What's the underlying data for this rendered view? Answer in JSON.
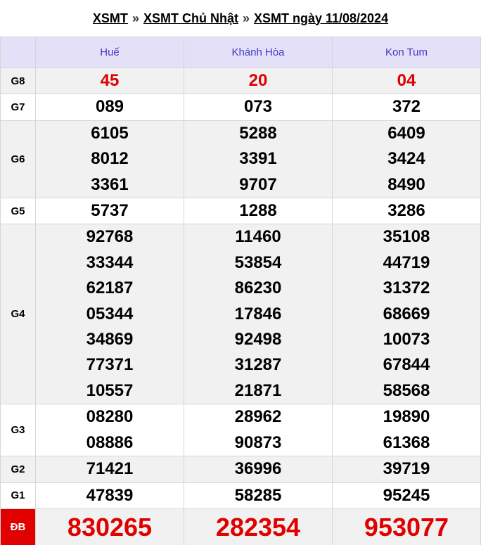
{
  "breadcrumb": {
    "items": [
      "XSMT",
      "XSMT Chủ Nhật",
      "XSMT ngày 11/08/2024"
    ],
    "separator": "»"
  },
  "colors": {
    "accent_red": "#e00000",
    "header_bg": "#e3e0f7",
    "header_text": "#4338ca"
  },
  "provinces": [
    "Huế",
    "Khánh Hòa",
    "Kon Tum"
  ],
  "prizes": [
    {
      "label": "G8",
      "values": [
        [
          "45"
        ],
        [
          "20"
        ],
        [
          "04"
        ]
      ]
    },
    {
      "label": "G7",
      "values": [
        [
          "089"
        ],
        [
          "073"
        ],
        [
          "372"
        ]
      ]
    },
    {
      "label": "G6",
      "values": [
        [
          "6105",
          "8012",
          "3361"
        ],
        [
          "5288",
          "3391",
          "9707"
        ],
        [
          "6409",
          "3424",
          "8490"
        ]
      ]
    },
    {
      "label": "G5",
      "values": [
        [
          "5737"
        ],
        [
          "1288"
        ],
        [
          "3286"
        ]
      ]
    },
    {
      "label": "G4",
      "values": [
        [
          "92768",
          "33344",
          "62187",
          "05344",
          "34869",
          "77371",
          "10557"
        ],
        [
          "11460",
          "53854",
          "86230",
          "17846",
          "92498",
          "31287",
          "21871"
        ],
        [
          "35108",
          "44719",
          "31372",
          "68669",
          "10073",
          "67844",
          "58568"
        ]
      ]
    },
    {
      "label": "G3",
      "values": [
        [
          "08280",
          "08886"
        ],
        [
          "28962",
          "90873"
        ],
        [
          "19890",
          "61368"
        ]
      ]
    },
    {
      "label": "G2",
      "values": [
        [
          "71421"
        ],
        [
          "36996"
        ],
        [
          "39719"
        ]
      ]
    },
    {
      "label": "G1",
      "values": [
        [
          "47839"
        ],
        [
          "58285"
        ],
        [
          "95245"
        ]
      ]
    },
    {
      "label": "ĐB",
      "values": [
        [
          "830265"
        ],
        [
          "282354"
        ],
        [
          "953077"
        ]
      ]
    }
  ]
}
